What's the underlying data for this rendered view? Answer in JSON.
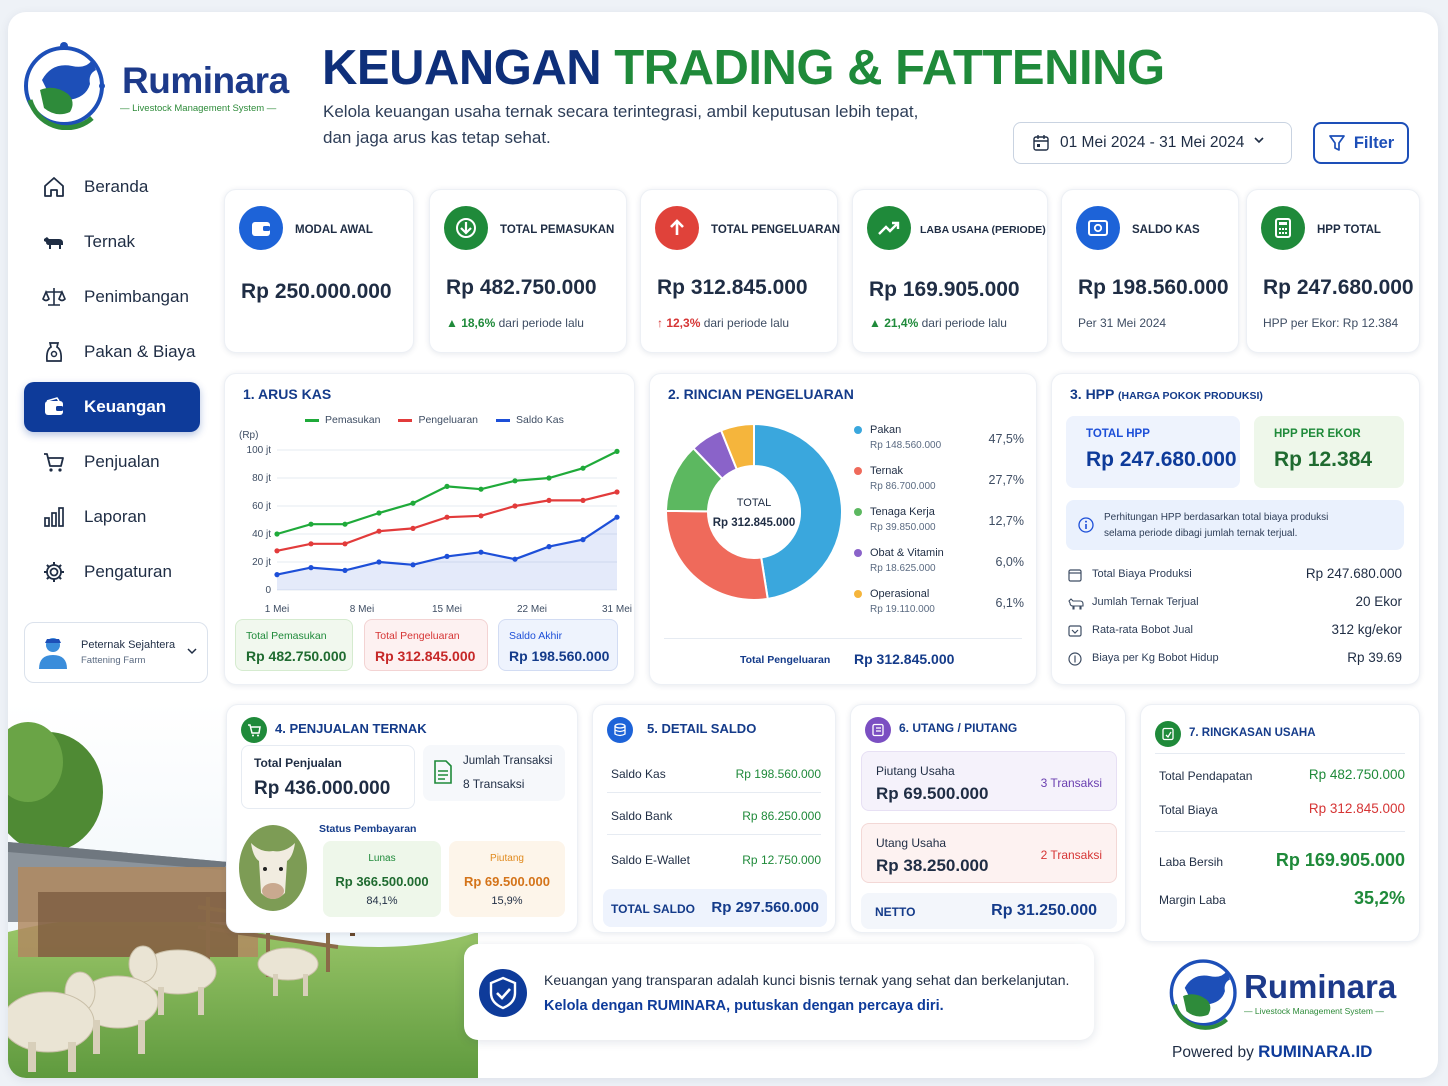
{
  "brand": {
    "name": "Ruminara",
    "tagline": "— Livestock Management System —",
    "powered_label": "Powered by",
    "powered_site": "RUMINARA.ID"
  },
  "sidebar": {
    "items": [
      {
        "label": "Beranda",
        "icon": "home-icon"
      },
      {
        "label": "Ternak",
        "icon": "cow-icon"
      },
      {
        "label": "Penimbangan",
        "icon": "scale-icon"
      },
      {
        "label": "Pakan & Biaya",
        "icon": "feed-bag-icon"
      },
      {
        "label": "Keuangan",
        "icon": "wallet-icon",
        "active": true
      },
      {
        "label": "Penjualan",
        "icon": "cart-icon"
      },
      {
        "label": "Laporan",
        "icon": "bar-chart-icon"
      },
      {
        "label": "Pengaturan",
        "icon": "gear-icon"
      }
    ],
    "user": {
      "name": "Peternak Sejahtera",
      "farm": "Fattening Farm"
    }
  },
  "header": {
    "title_part1": "KEUANGAN",
    "title_part2": "TRADING & FATTENING",
    "subtitle": "Kelola keuangan usaha ternak secara terintegrasi, ambil keputusan lebih tepat, dan jaga arus kas tetap sehat.",
    "date_range": "01 Mei 2024 - 31 Mei 2024",
    "filter_label": "Filter"
  },
  "kpis": [
    {
      "label": "MODAL AWAL",
      "value": "Rp 250.000.000",
      "note": "",
      "icon": "wallet-icon",
      "color": "#1d63d8"
    },
    {
      "label": "TOTAL PEMASUKAN",
      "value": "Rp 482.750.000",
      "delta": "▲ 18,6%",
      "note": "dari periode lalu",
      "icon": "arrow-down-icon",
      "color": "#1f8a3a"
    },
    {
      "label": "TOTAL PENGELUARAN",
      "value": "Rp 312.845.000",
      "delta": "↑ 12,3%",
      "note": "dari periode lalu",
      "icon": "arrow-up-icon",
      "color": "#e0423a"
    },
    {
      "label": "LABA USAHA (PERIODE)",
      "value": "Rp 169.905.000",
      "delta": "▲ 21,4%",
      "note": "dari periode lalu",
      "icon": "trend-up-icon",
      "color": "#1f8a3a"
    },
    {
      "label": "SALDO KAS",
      "value": "Rp 198.560.000",
      "note": "Per 31 Mei 2024",
      "icon": "cash-icon",
      "color": "#1d63d8"
    },
    {
      "label": "HPP TOTAL",
      "value": "Rp 247.680.000",
      "note": "HPP per Ekor: Rp 12.384",
      "icon": "calculator-icon",
      "color": "#1f8a3a"
    }
  ],
  "arus_kas": {
    "title": "1.  ARUS KAS",
    "y_unit": "(Rp)",
    "legend": [
      "Pemasukan",
      "Pengeluaran",
      "Saldo Kas"
    ],
    "yticks": [
      "100 jt",
      "80 jt",
      "60 jt",
      "40 jt",
      "20 jt",
      "0"
    ],
    "xticks": [
      "1 Mei",
      "8 Mei",
      "15 Mei",
      "22 Mei",
      "31 Mei"
    ],
    "summary": [
      {
        "label": "Total Pemasukan",
        "value": "Rp 482.750.000"
      },
      {
        "label": "Total Pengeluaran",
        "value": "Rp 312.845.000"
      },
      {
        "label": "Saldo Akhir",
        "value": "Rp 198.560.000"
      }
    ]
  },
  "chart_data": {
    "type": "line",
    "x": [
      "1 Mei",
      "4 Mei",
      "7 Mei",
      "10 Mei",
      "13 Mei",
      "16 Mei",
      "19 Mei",
      "22 Mei",
      "25 Mei",
      "28 Mei",
      "31 Mei"
    ],
    "series": [
      {
        "name": "Pemasukan",
        "values": [
          40,
          47,
          47,
          55,
          62,
          74,
          72,
          78,
          80,
          87,
          99
        ],
        "color": "#1faa3a"
      },
      {
        "name": "Pengeluaran",
        "values": [
          28,
          33,
          33,
          42,
          44,
          52,
          53,
          60,
          64,
          64,
          70
        ],
        "color": "#e23b3b"
      },
      {
        "name": "Saldo Kas",
        "values": [
          11,
          16,
          14,
          20,
          18,
          24,
          27,
          22,
          31,
          36,
          52
        ],
        "color": "#1d4fd8"
      }
    ],
    "ylabel": "(Rp)",
    "ylim": [
      0,
      100
    ],
    "grid": true,
    "legend_position": "top"
  },
  "pengeluaran": {
    "title": "2.  RINCIAN PENGELUARAN",
    "center_label": "TOTAL",
    "center_value": "Rp 312.845.000",
    "items": [
      {
        "name": "Pakan",
        "amount": "Rp 148.560.000",
        "pct": "47,5%",
        "value": 47.5,
        "color": "#3aa7dd"
      },
      {
        "name": "Ternak",
        "amount": "Rp 86.700.000",
        "pct": "27,7%",
        "value": 27.7,
        "color": "#ef6a5b"
      },
      {
        "name": "Tenaga Kerja",
        "amount": "Rp 39.850.000",
        "pct": "12,7%",
        "value": 12.7,
        "color": "#5cb860"
      },
      {
        "name": "Obat & Vitamin",
        "amount": "Rp 18.625.000",
        "pct": "6,0%",
        "value": 6.0,
        "color": "#8a63c9"
      },
      {
        "name": "Operasional",
        "amount": "Rp 19.110.000",
        "pct": "6,1%",
        "value": 6.1,
        "color": "#f5b53c"
      }
    ],
    "footer_label": "Total Pengeluaran",
    "footer_value": "Rp 312.845.000"
  },
  "hpp": {
    "title": "3.  HPP",
    "title_sub": "(HARGA POKOK PRODUKSI)",
    "total_label": "TOTAL HPP",
    "total_value": "Rp 247.680.000",
    "per_ekor_label": "HPP PER EKOR",
    "per_ekor_value": "Rp 12.384",
    "info_line1": "Perhitungan HPP berdasarkan total biaya produksi",
    "info_line2": "selama periode dibagi jumlah ternak terjual.",
    "rows": [
      {
        "label": "Total Biaya Produksi",
        "value": "Rp 247.680.000"
      },
      {
        "label": "Jumlah Ternak Terjual",
        "value": "20 Ekor"
      },
      {
        "label": "Rata-rata Bobot Jual",
        "value": "312 kg/ekor"
      },
      {
        "label": "Biaya per Kg Bobot Hidup",
        "value": "Rp 39.69"
      }
    ]
  },
  "penjualan": {
    "title": "4.  PENJUALAN TERNAK",
    "total_label": "Total Penjualan",
    "total_value": "Rp 436.000.000",
    "trx_label": "Jumlah Transaksi",
    "trx_value": "8 Transaksi",
    "status_label": "Status Pembayaran",
    "lunas_label": "Lunas",
    "lunas_value": "Rp 366.500.000",
    "lunas_pct": "84,1%",
    "piutang_label": "Piutang",
    "piutang_value": "Rp 69.500.000",
    "piutang_pct": "15,9%"
  },
  "saldo": {
    "title": "5.  DETAIL SALDO",
    "rows": [
      {
        "label": "Saldo Kas",
        "value": "Rp 198.560.000"
      },
      {
        "label": "Saldo Bank",
        "value": "Rp  86.250.000"
      },
      {
        "label": "Saldo E-Wallet",
        "value": "Rp  12.750.000"
      }
    ],
    "total_label": "TOTAL SALDO",
    "total_value": "Rp 297.560.000"
  },
  "utang": {
    "title": "6.  UTANG / PIUTANG",
    "piutang_label": "Piutang Usaha",
    "piutang_value": "Rp 69.500.000",
    "piutang_trx": "3 Transaksi",
    "utang_label": "Utang Usaha",
    "utang_value": "Rp 38.250.000",
    "utang_trx": "2 Transaksi",
    "netto_label": "NETTO",
    "netto_value": "Rp 31.250.000"
  },
  "ringkasan": {
    "title": "7.  RINGKASAN USAHA",
    "pendapatan_label": "Total Pendapatan",
    "pendapatan_value": "Rp 482.750.000",
    "biaya_label": "Total Biaya",
    "biaya_value": "Rp 312.845.000",
    "laba_label": "Laba Bersih",
    "laba_value": "Rp 169.905.000",
    "margin_label": "Margin Laba",
    "margin_value": "35,2%"
  },
  "banner": {
    "line1": "Keuangan yang transparan adalah kunci bisnis ternak yang sehat dan berkelanjutan.",
    "line2": "Kelola dengan RUMINARA, putuskan dengan percaya diri."
  },
  "colors": {
    "primary": "#0e3b9a",
    "green": "#1f8a3a",
    "red": "#d63535",
    "blue": "#1d4fd8"
  }
}
